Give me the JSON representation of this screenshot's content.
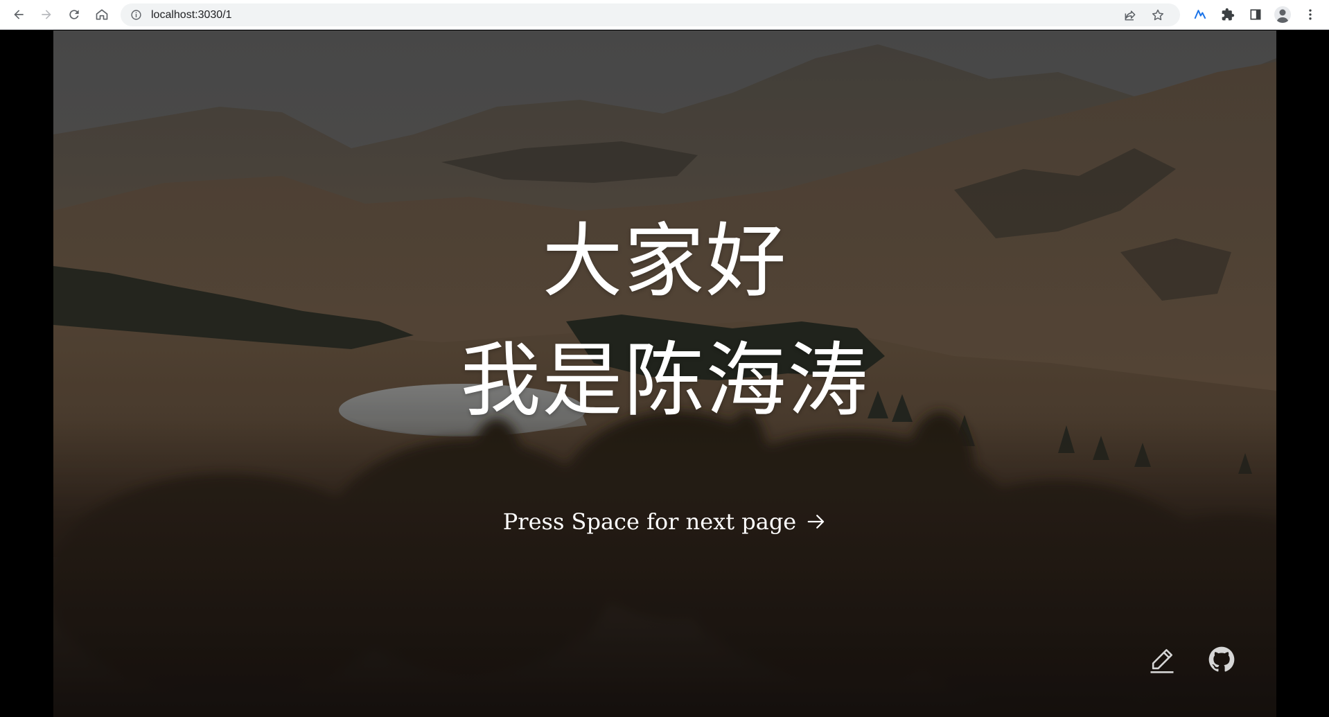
{
  "browser": {
    "url": "localhost:3030/1"
  },
  "slide": {
    "title_line1": "大家好",
    "title_line2": "我是陈海涛",
    "next_hint": "Press Space for next page"
  },
  "colors": {
    "browser_bg": "#ffffff",
    "omnibox_bg": "#f1f3f4",
    "icon": "#5f6368",
    "accent": "#1a73e8",
    "slide_text": "#ffffff"
  },
  "icons": {
    "back": "arrow-left-icon",
    "forward": "arrow-right-icon",
    "reload": "reload-icon",
    "home": "home-icon",
    "site_info": "info-icon",
    "share": "share-icon",
    "bookmark": "star-icon",
    "extension_n": "nuxt-extension-icon",
    "extensions": "puzzle-icon",
    "side_panel": "side-panel-icon",
    "profile": "avatar-icon",
    "menu": "kebab-menu-icon",
    "next_arrow": "arrow-right-icon",
    "edit": "pencil-icon",
    "github": "github-icon"
  }
}
